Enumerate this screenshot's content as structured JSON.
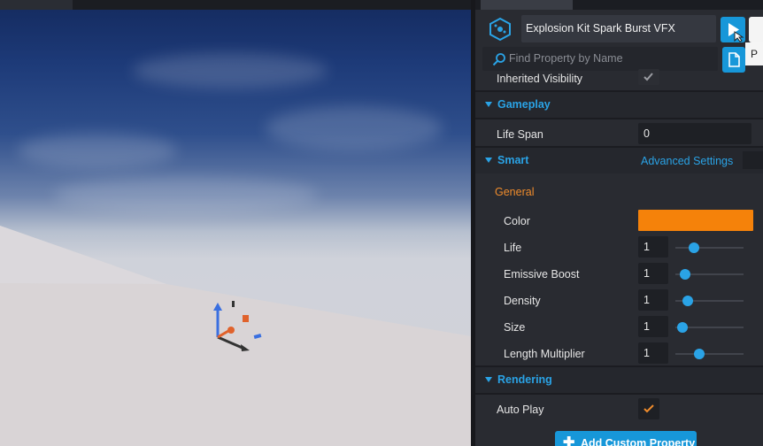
{
  "object": {
    "name": "Explosion Kit Spark Burst VFX"
  },
  "search": {
    "placeholder": "Find Property by Name"
  },
  "tooltip": {
    "text": "P"
  },
  "rows": {
    "inherited_visibility": {
      "label": "Inherited Visibility",
      "checked": true
    }
  },
  "gameplay": {
    "title": "Gameplay",
    "life_span": {
      "label": "Life Span",
      "value": "0"
    }
  },
  "smart": {
    "title": "Smart",
    "advanced_link": "Advanced Settings",
    "group": "General",
    "color": {
      "label": "Color",
      "value": "#f5820a"
    },
    "sliders": [
      {
        "label": "Life",
        "value": "1",
        "level": 0.27
      },
      {
        "label": "Emissive Boost",
        "value": "1",
        "level": 0.14
      },
      {
        "label": "Density",
        "value": "1",
        "level": 0.18
      },
      {
        "label": "Size",
        "value": "1",
        "level": 0.1
      },
      {
        "label": "Length Multiplier",
        "value": "1",
        "level": 0.35
      }
    ]
  },
  "rendering": {
    "title": "Rendering",
    "auto_play": {
      "label": "Auto Play",
      "checked": true
    }
  },
  "add_property": {
    "label": "Add Custom Property"
  },
  "colors": {
    "accent": "#2aa3e6",
    "button": "#1797d9",
    "general_label": "#f08c2c"
  }
}
